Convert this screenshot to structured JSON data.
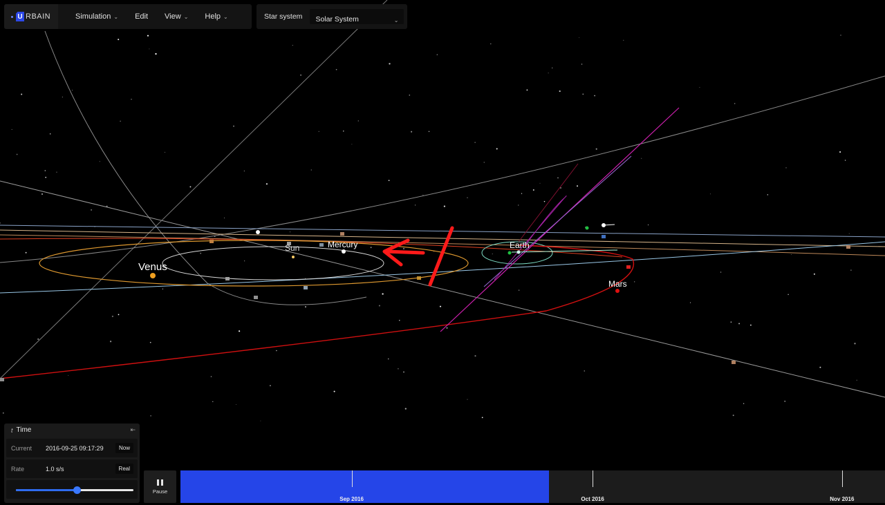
{
  "app": {
    "logo_letter": "U",
    "logo_text": "RBAIN",
    "menu": [
      {
        "label": "Simulation"
      },
      {
        "label": "Edit"
      },
      {
        "label": "View"
      },
      {
        "label": "Help"
      }
    ],
    "star_system": {
      "label": "Star system",
      "selected": "Solar System"
    }
  },
  "scene": {
    "bodies": [
      {
        "name": "Sun",
        "label": "Sun"
      },
      {
        "name": "Mercury",
        "label": "Mercury"
      },
      {
        "name": "Venus",
        "label": "Venus"
      },
      {
        "name": "Earth",
        "label": "Earth"
      },
      {
        "name": "Mars",
        "label": "Mars"
      }
    ],
    "colors": {
      "venus": "#f0a020",
      "mars": "#e01010",
      "mercury_orbit": "#cfcfcf",
      "earth_orbit": "#7fe0c8",
      "comet": "#d020b0",
      "annotation": "#ff1a1a"
    }
  },
  "time": {
    "title": "Time",
    "current_label": "Current",
    "current_value": "2016-09-25 09:17:29",
    "now_button": "Now",
    "rate_label": "Rate",
    "rate_value": "1.0 s/s",
    "real_button": "Real",
    "slider_level": 0.52
  },
  "playback": {
    "pause_label": "Pause"
  },
  "timeline": {
    "progress": 0.523,
    "ticks": [
      {
        "label": "Sep 2016",
        "pos": 0.243
      },
      {
        "label": "Oct 2016",
        "pos": 0.585
      },
      {
        "label": "Nov 2016",
        "pos": 0.939
      }
    ]
  }
}
